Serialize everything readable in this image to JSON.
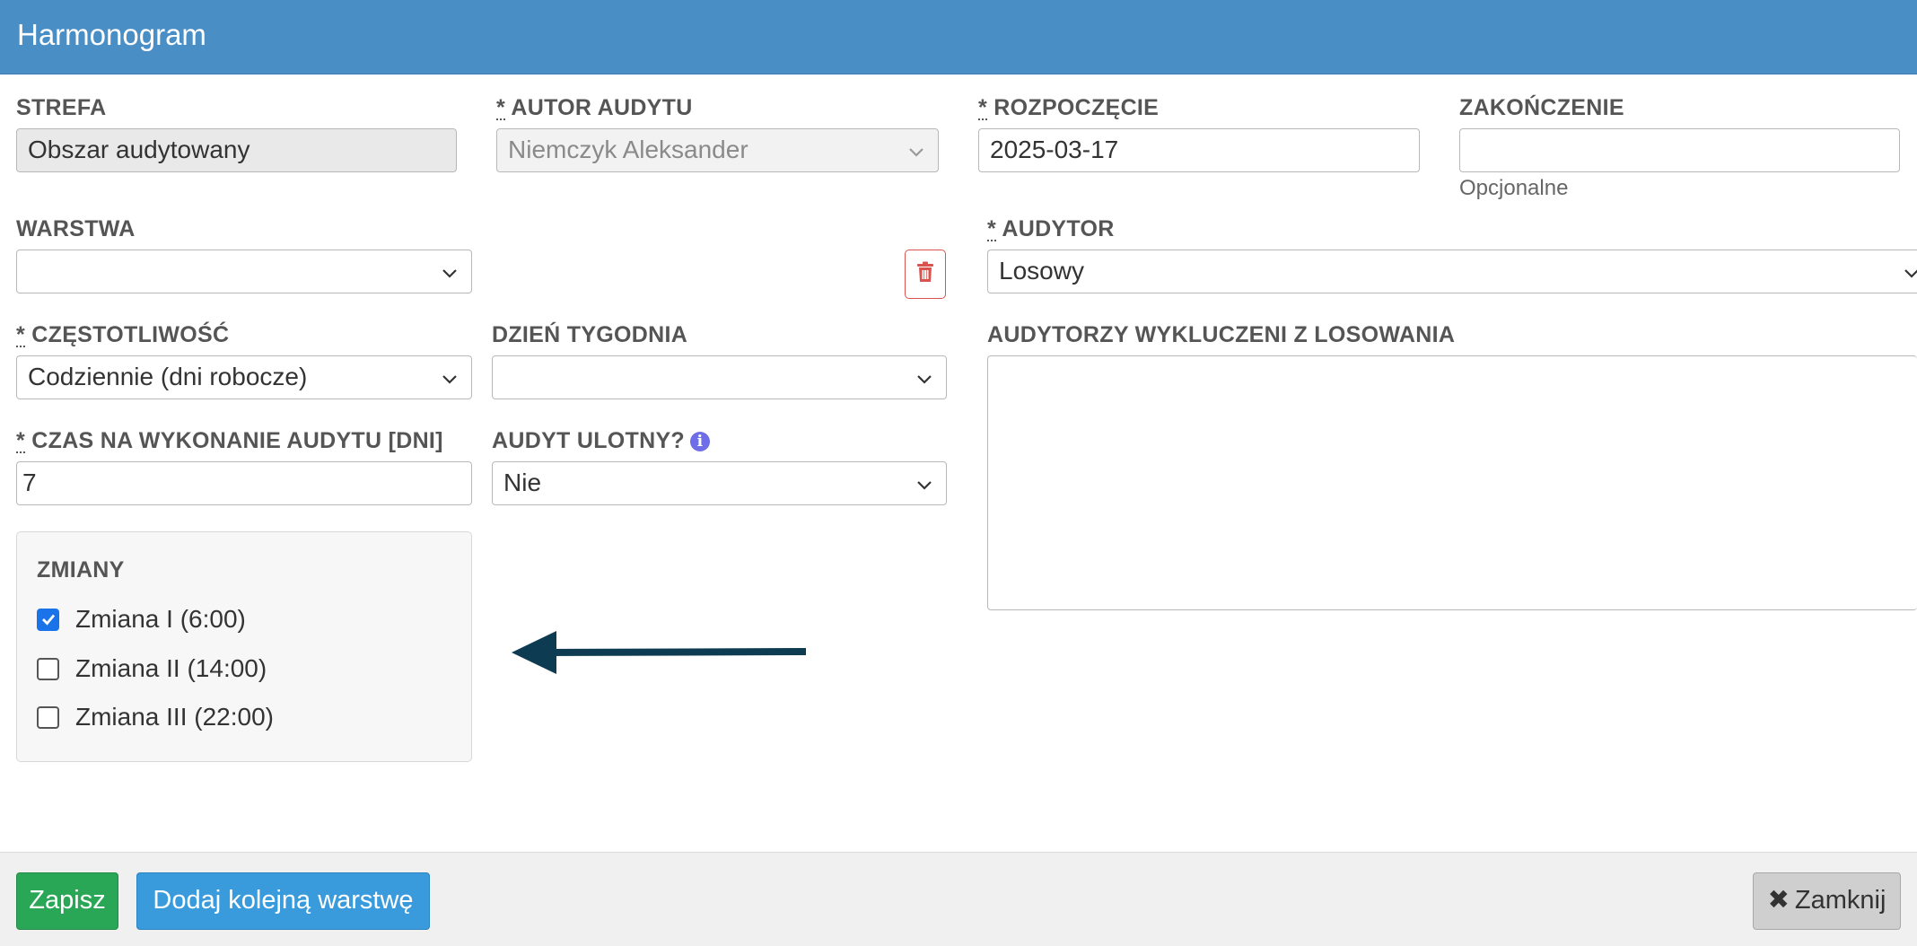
{
  "dialog": {
    "title": "Harmonogram"
  },
  "form": {
    "zone": {
      "label": "STREFA",
      "value": "Obszar audytowany"
    },
    "audit_author": {
      "required_mark": "*",
      "label": "AUTOR AUDYTU",
      "value": "Niemczyk Aleksander"
    },
    "start": {
      "required_mark": "*",
      "label": "ROZPOCZĘCIE",
      "value": "2025-03-17"
    },
    "end": {
      "label": "ZAKOŃCZENIE",
      "value": "",
      "help": "Opcjonalne"
    },
    "layer": {
      "label": "WARSTWA",
      "value": ""
    },
    "auditor": {
      "required_mark": "*",
      "label": "AUDYTOR",
      "value": "Losowy"
    },
    "frequency": {
      "required_mark": "*",
      "label": "CZĘSTOTLIWOŚĆ",
      "value": "Codziennie (dni robocze)"
    },
    "weekday": {
      "label": "DZIEŃ TYGODNIA",
      "value": ""
    },
    "excluded_auditors": {
      "label": "AUDYTORZY WYKLUCZENI Z LOSOWANIA",
      "value": ""
    },
    "duration": {
      "required_mark": "*",
      "label": "CZAS NA WYKONANIE AUDYTU [DNI]",
      "value": "7"
    },
    "volatile": {
      "label": "AUDYT ULOTNY?",
      "value": "Nie",
      "icon": "info-icon"
    },
    "shifts": {
      "label": "ZMIANY",
      "items": [
        {
          "label": "Zmiana I (6:00)",
          "checked": true
        },
        {
          "label": "Zmiana II (14:00)",
          "checked": false
        },
        {
          "label": "Zmiana III (22:00)",
          "checked": false
        }
      ]
    }
  },
  "footer": {
    "save_label": "Zapisz",
    "add_layer_label": "Dodaj kolejną warstwę",
    "close_label": "Zamknij",
    "close_icon": "times-icon"
  },
  "colors": {
    "header": "#4a8ec6",
    "save": "#2aa756",
    "add": "#3a9bdc",
    "delete": "#d9534f",
    "arrow": "#0d3b52",
    "checkbox_checked": "#1a73e8"
  }
}
